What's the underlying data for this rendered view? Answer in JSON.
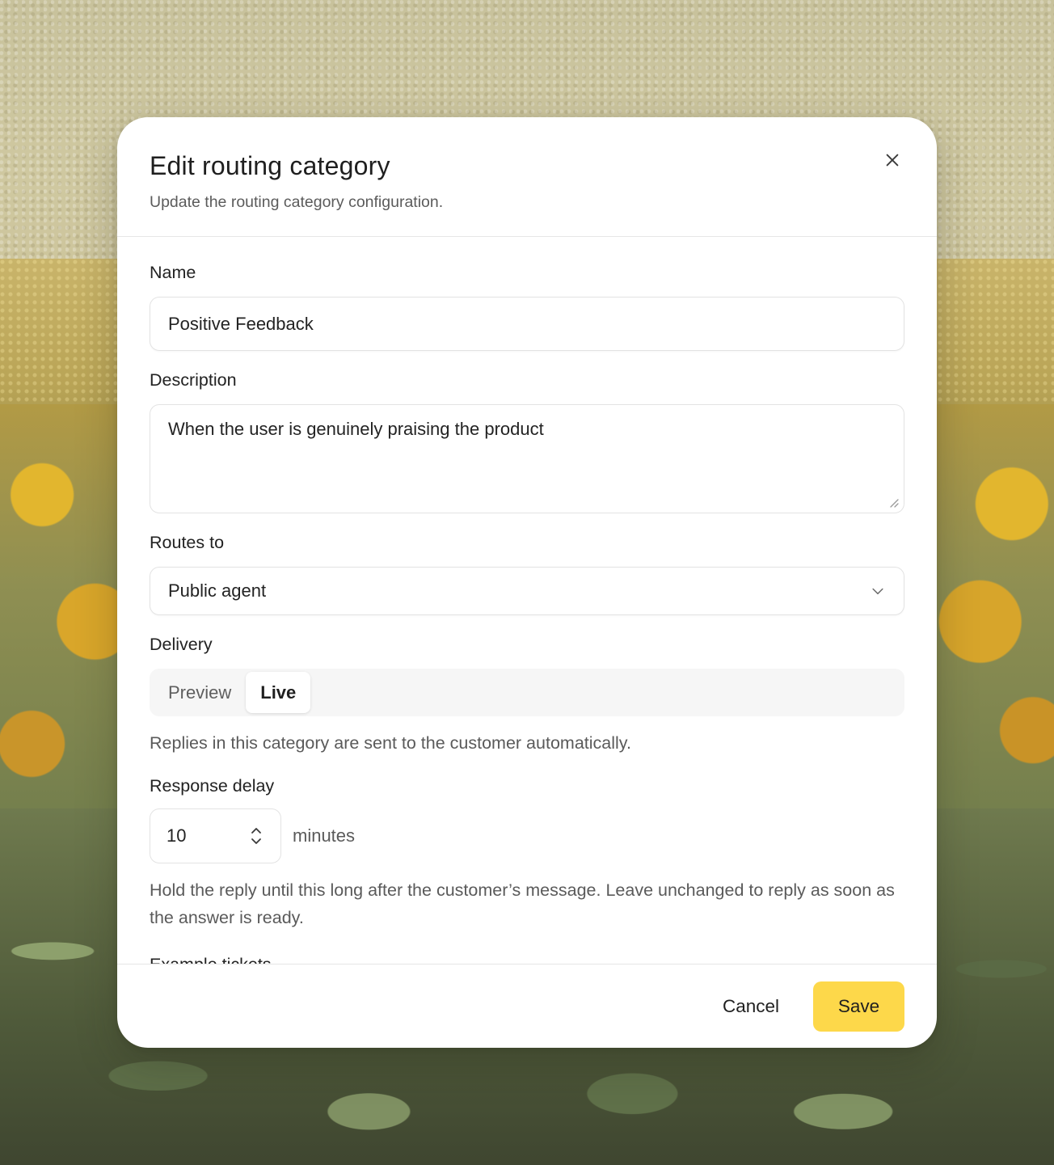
{
  "dialog": {
    "title": "Edit routing category",
    "subtitle": "Update the routing category configuration.",
    "close_icon": "close-icon"
  },
  "form": {
    "name": {
      "label": "Name",
      "value": "Positive Feedback"
    },
    "description": {
      "label": "Description",
      "value": "When the user is genuinely praising the product"
    },
    "routes_to": {
      "label": "Routes to",
      "selected": "Public agent",
      "icon": "chevron-down-icon"
    },
    "delivery": {
      "label": "Delivery",
      "options": [
        {
          "label": "Preview",
          "active": false
        },
        {
          "label": "Live",
          "active": true
        }
      ],
      "help": "Replies in this category are sent to the customer automatically."
    },
    "response_delay": {
      "label": "Response delay",
      "value": "10",
      "unit": "minutes",
      "help": "Hold the reply until this long after the customer’s message. Leave unchanged to reply as soon as the answer is ready."
    },
    "next_section_label": "Example tickets"
  },
  "footer": {
    "cancel_label": "Cancel",
    "save_label": "Save"
  },
  "colors": {
    "save_bg": "#fdd84a",
    "dialog_bg": "#ffffff",
    "segment_bg": "#f6f6f6"
  }
}
